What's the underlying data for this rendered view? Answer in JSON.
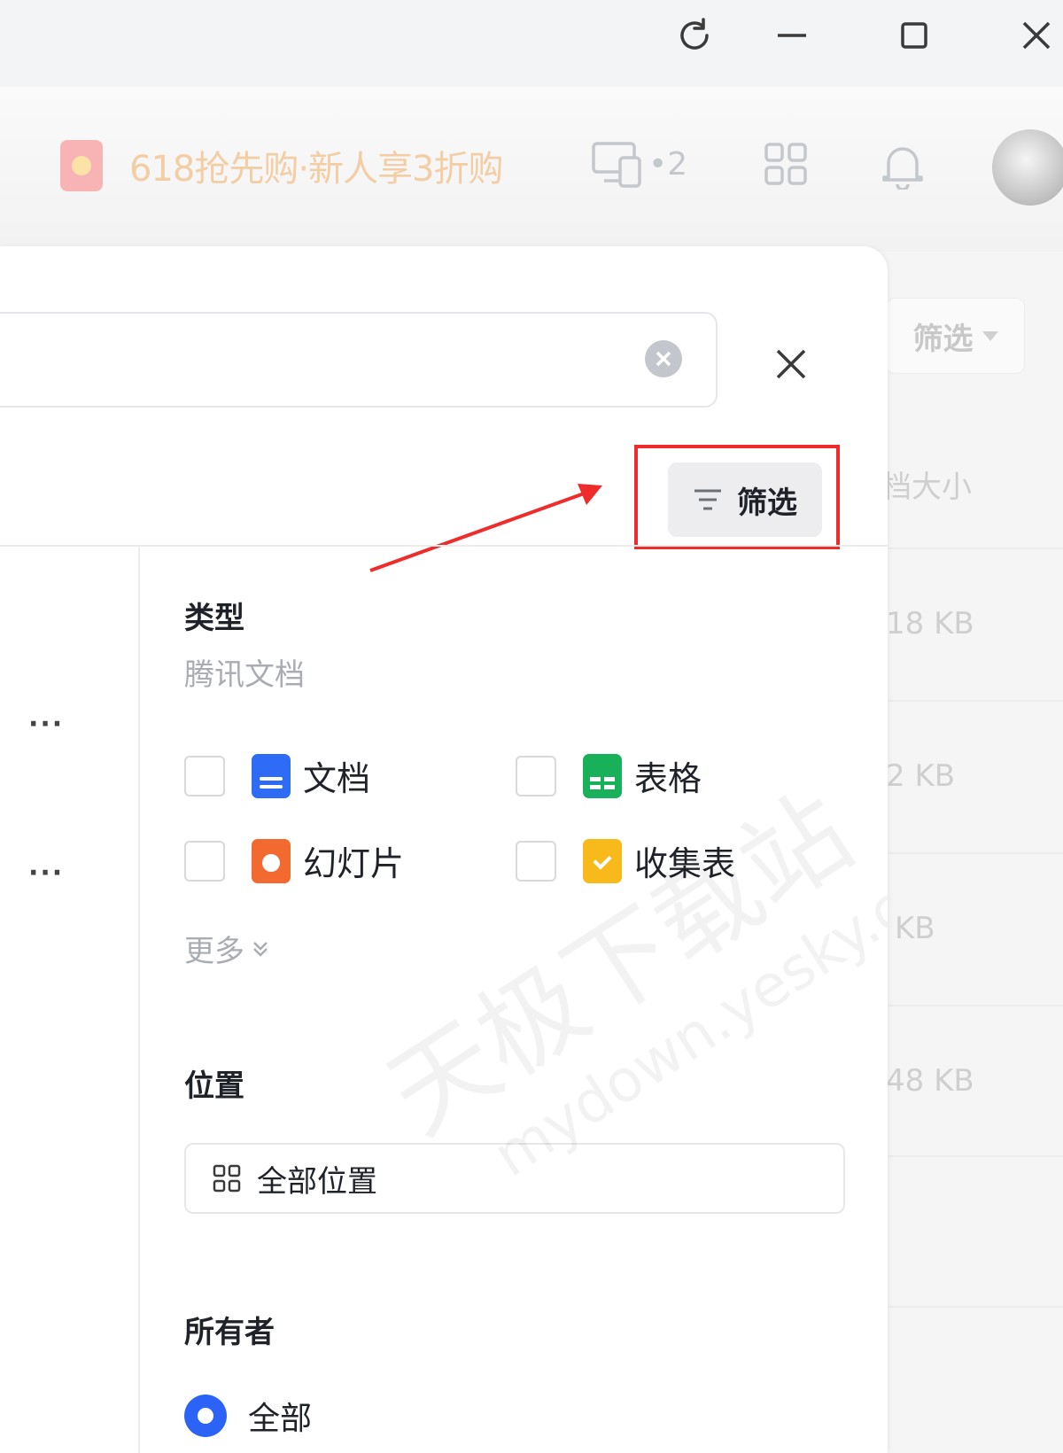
{
  "window_controls": {
    "refresh": "refresh-icon",
    "minimize": "minimize-icon",
    "maximize": "maximize-icon",
    "close": "close-icon"
  },
  "header": {
    "promo_text": "618抢先购·新人享3折购",
    "device_count": "•2"
  },
  "background_page": {
    "filter_label": "筛选",
    "column_header": "档大小",
    "sizes": [
      "18 KB",
      "2 KB",
      "KB",
      "48 KB"
    ]
  },
  "panel": {
    "filter_button_label": "筛选",
    "type_section": {
      "title": "类型",
      "subtitle": "腾讯文档",
      "options": [
        {
          "label": "文档",
          "icon": "doc-icon",
          "checked": false
        },
        {
          "label": "表格",
          "icon": "sheet-icon",
          "checked": false
        },
        {
          "label": "幻灯片",
          "icon": "slide-icon",
          "checked": false
        },
        {
          "label": "收集表",
          "icon": "collect-form-icon",
          "checked": false
        }
      ],
      "more_label": "更多"
    },
    "location_section": {
      "title": "位置",
      "selected": "全部位置"
    },
    "owner_section": {
      "title": "所有者",
      "selected": "全部"
    }
  },
  "watermark": {
    "line1": "天极下载站",
    "line2": "mydown.yesky.com"
  },
  "colors": {
    "accent": "#2a63f5",
    "highlight": "#f02b2b",
    "promo": "#f3cda4"
  }
}
